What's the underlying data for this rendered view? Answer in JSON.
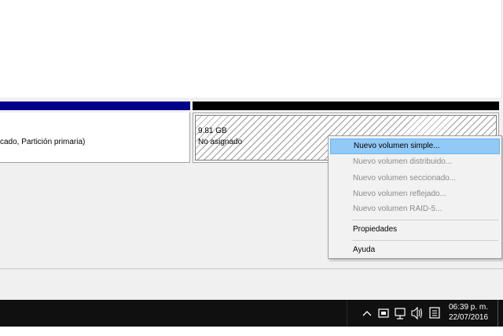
{
  "partitions": {
    "primary_text": "cado, Partición primaria)",
    "unallocated_size": "9.81 GB",
    "unallocated_label": "No asignado"
  },
  "colors": {
    "primary_bar": "#00008a",
    "unallocated_bar": "#000000",
    "menu_highlight": "#91c9f7"
  },
  "context_menu": {
    "items": [
      {
        "label": "Nuevo volumen simple...",
        "enabled": true
      },
      {
        "label": "Nuevo volumen distribuido...",
        "enabled": false
      },
      {
        "label": "Nuevo volumen seccionado...",
        "enabled": false
      },
      {
        "label": "Nuevo volumen reflejado...",
        "enabled": false
      },
      {
        "label": "Nuevo volumen RAID-5...",
        "enabled": false
      },
      {
        "label": "Propiedades",
        "enabled": true
      },
      {
        "label": "Ayuda",
        "enabled": true
      }
    ]
  },
  "taskbar": {
    "tray_icons": [
      "chevron-up-icon",
      "keyboard-icon",
      "network-icon",
      "volume-icon",
      "notifications-icon"
    ],
    "time": "06:39 p. m.",
    "date": "22/07/2016"
  }
}
